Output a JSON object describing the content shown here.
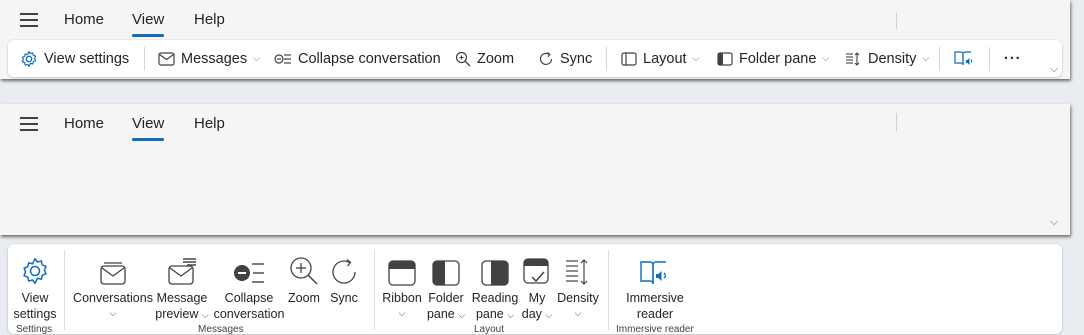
{
  "top": {
    "tabs": [
      {
        "label": "Home"
      },
      {
        "label": "View"
      },
      {
        "label": "Help"
      }
    ],
    "ribbon": {
      "view_settings": "View settings",
      "messages": "Messages",
      "collapse_conversation": "Collapse conversation",
      "zoom": "Zoom",
      "sync": "Sync",
      "layout": "Layout",
      "folder_pane": "Folder pane",
      "density": "Density",
      "more": "···"
    }
  },
  "bottom": {
    "tabs": [
      {
        "label": "Home"
      },
      {
        "label": "View"
      },
      {
        "label": "Help"
      }
    ],
    "items": {
      "view_settings_1": "View",
      "view_settings_2": "settings",
      "conversations": "Conversations",
      "message_preview_1": "Message",
      "message_preview_2": "preview",
      "collapse_1": "Collapse",
      "collapse_2": "conversation",
      "zoom": "Zoom",
      "sync": "Sync",
      "ribbon": "Ribbon",
      "folder_pane_1": "Folder",
      "folder_pane_2": "pane",
      "reading_pane_1": "Reading",
      "reading_pane_2": "pane",
      "my_day_1": "My",
      "my_day_2": "day",
      "density": "Density",
      "immersive_1": "Immersive",
      "immersive_2": "reader"
    },
    "groups": {
      "settings": "Settings",
      "messages": "Messages",
      "layout": "Layout",
      "immersive_reader": "Immersive reader"
    }
  },
  "colors": {
    "accent": "#0f6cbd"
  }
}
